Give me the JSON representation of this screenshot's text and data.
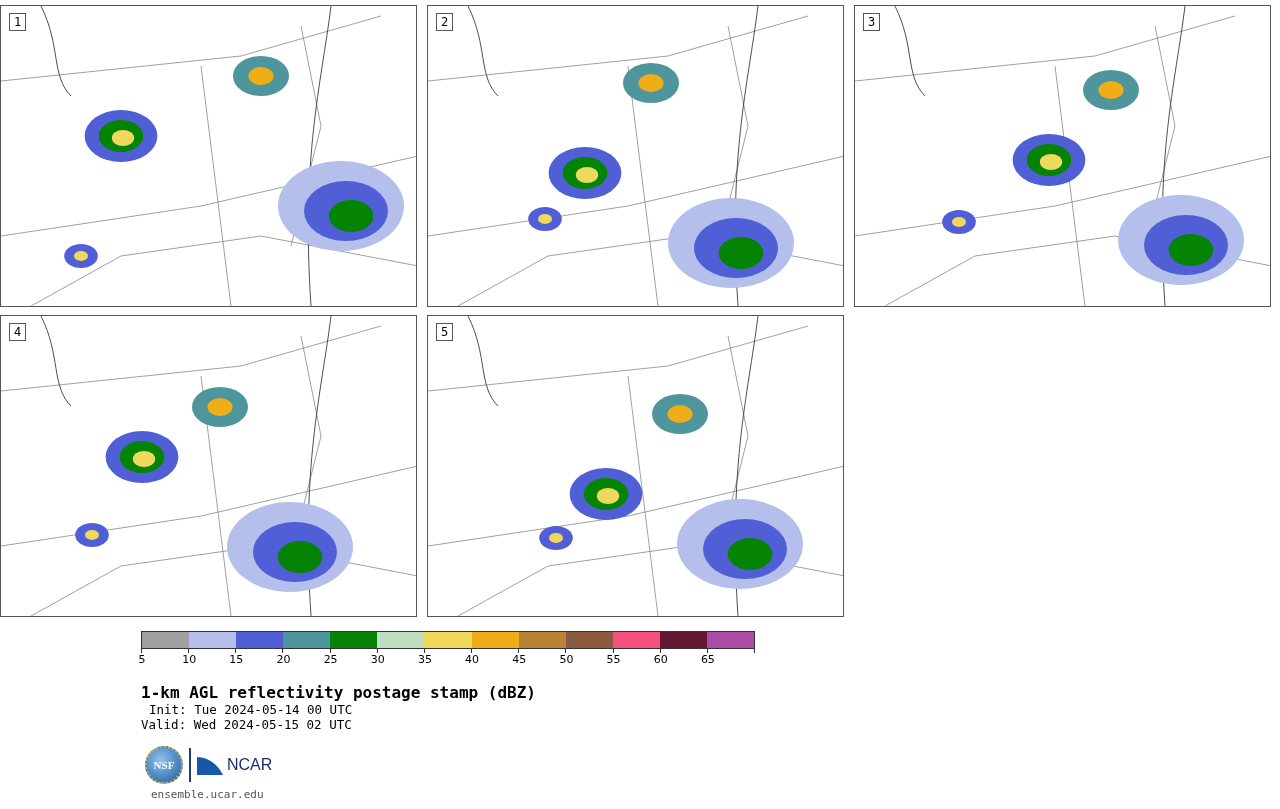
{
  "panels": [
    {
      "label": "1"
    },
    {
      "label": "2"
    },
    {
      "label": "3"
    },
    {
      "label": "4"
    },
    {
      "label": "5"
    }
  ],
  "colorbar": {
    "segments": [
      {
        "label": "5",
        "color": "#a0a0a0"
      },
      {
        "label": "10",
        "color": "#b4bfec"
      },
      {
        "label": "15",
        "color": "#505fd6"
      },
      {
        "label": "20",
        "color": "#4f959c"
      },
      {
        "label": "25",
        "color": "#048304"
      },
      {
        "label": "30",
        "color": "#bedfbf"
      },
      {
        "label": "35",
        "color": "#eed95c"
      },
      {
        "label": "40",
        "color": "#efad17"
      },
      {
        "label": "45",
        "color": "#ba8232"
      },
      {
        "label": "50",
        "color": "#8a5b40"
      },
      {
        "label": "55",
        "color": "#f54f7c"
      },
      {
        "label": "60",
        "color": "#631735"
      },
      {
        "label": "65",
        "color": "#ab4ba2"
      }
    ]
  },
  "title": "1-km AGL reflectivity postage stamp (dBZ)",
  "init": "Init: Tue 2024-05-14 00 UTC",
  "valid": "Valid: Wed 2024-05-15 02 UTC",
  "logos": {
    "nsf": "NSF",
    "ncar": "NCAR"
  },
  "url": "ensemble.ucar.edu"
}
